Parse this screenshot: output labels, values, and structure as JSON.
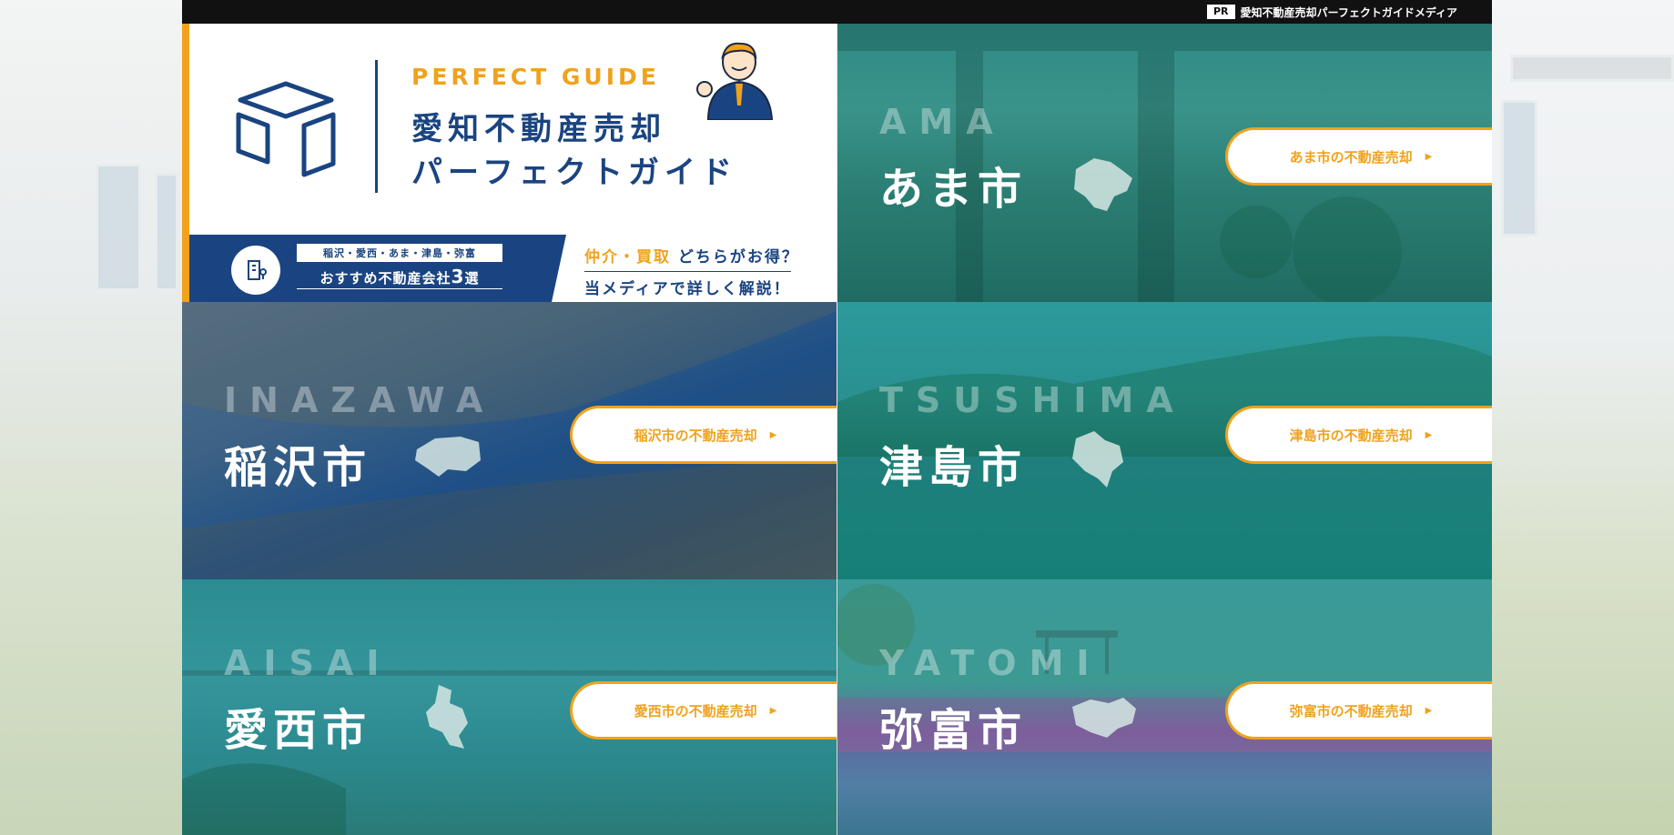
{
  "topbar": {
    "pr_badge": "PR",
    "site_tagline": "愛知不動産売却パーフェクトガイドメディア"
  },
  "hero": {
    "subtitle": "PERFECT GUIDE",
    "title_line1": "愛知不動産売却",
    "title_line2": "パーフェクトガイド",
    "banner_tag": "稲沢・愛西・あま・津島・弥富",
    "banner_main_prefix": "おすすめ不動産会社",
    "banner_main_number": "3",
    "banner_main_suffix": "選",
    "question_accent": "仲介・買取",
    "question_rest": "どちらがお得？",
    "answer": "当メディアで詳しく解説！"
  },
  "cities": {
    "ama": {
      "romaji": "AMA",
      "name": "あま市",
      "cta": "あま市の不動産売却"
    },
    "inazawa": {
      "romaji": "INAZAWA",
      "name": "稲沢市",
      "cta": "稲沢市の不動産売却"
    },
    "tsushima": {
      "romaji": "TSUSHIMA",
      "name": "津島市",
      "cta": "津島市の不動産売却"
    },
    "aisai": {
      "romaji": "AISAI",
      "name": "愛西市",
      "cta": "愛西市の不動産売却"
    },
    "yatomi": {
      "romaji": "YATOMI",
      "name": "弥富市",
      "cta": "弥富市の不動産売却"
    }
  },
  "colors": {
    "brand_navy": "#1a4481",
    "accent_orange": "#f0a21e"
  }
}
